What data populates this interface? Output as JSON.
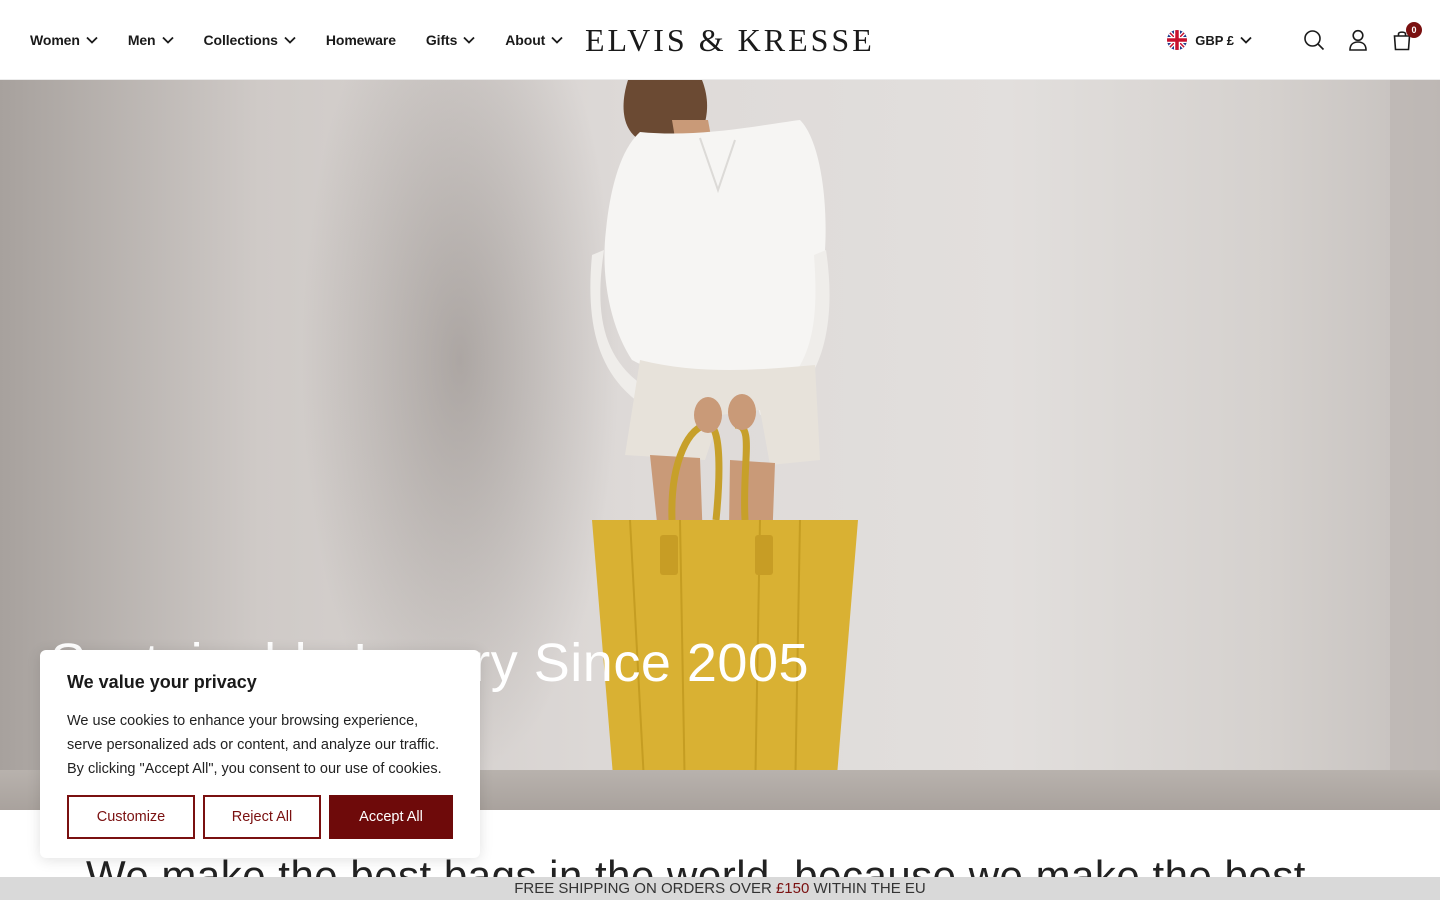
{
  "header": {
    "logo": "ELVIS & KRESSE",
    "nav": [
      {
        "label": "Women",
        "has_dropdown": true
      },
      {
        "label": "Men",
        "has_dropdown": true
      },
      {
        "label": "Collections",
        "has_dropdown": true
      },
      {
        "label": "Homeware",
        "has_dropdown": false
      },
      {
        "label": "Gifts",
        "has_dropdown": true
      },
      {
        "label": "About",
        "has_dropdown": true
      }
    ],
    "currency": {
      "label": "GBP £",
      "flag": "uk-flag-icon"
    },
    "cart_count": "0",
    "icons": [
      "search-icon",
      "account-icon",
      "cart-icon"
    ]
  },
  "hero": {
    "title": "Sustainable Luxury Since 2005",
    "image_alt": "Woman holding yellow leather tote bag"
  },
  "tagline": "We make the best bags in the world, because we make the best",
  "shipping_bar": {
    "prefix": "FREE SHIPPING ON ORDERS OVER ",
    "price": "£150",
    "suffix": " WITHIN THE EU"
  },
  "cookie": {
    "title": "We value your privacy",
    "body": "We use cookies to enhance your browsing experience, serve personalized ads or content, and analyze our traffic. By clicking \"Accept All\", you consent to our use of cookies.",
    "customize": "Customize",
    "reject": "Reject All",
    "accept": "Accept All"
  },
  "colors": {
    "accent": "#6e0a0a",
    "shipping_bar": "#d9d9d9",
    "text": "#1a1a1a"
  }
}
